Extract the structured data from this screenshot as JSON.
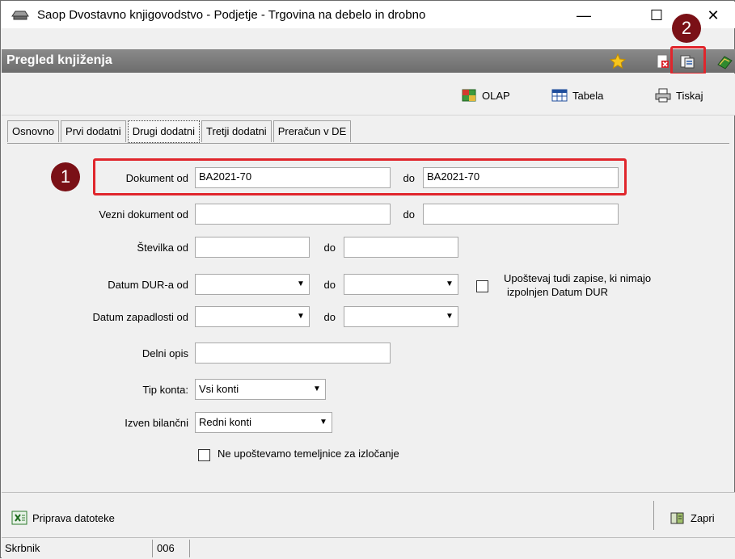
{
  "window": {
    "title": "Saop Dvostavno knjigovodstvo - Podjetje - Trgovina na debelo in drobno",
    "min": "—",
    "max": "☐",
    "close": "✕"
  },
  "header": {
    "title": "Pregled knjiženja"
  },
  "toolbar": {
    "olap": "OLAP",
    "tabela": "Tabela",
    "tiskaj": "Tiskaj"
  },
  "tabs": [
    "Osnovno",
    "Prvi dodatni",
    "Drugi dodatni",
    "Tretji dodatni",
    "Preračun v DE"
  ],
  "form": {
    "dokument_label": "Dokument od",
    "dokument_from": "BA2021-70",
    "dokument_to": "BA2021-70",
    "vezni_label": "Vezni dokument od",
    "vezni_from": "",
    "vezni_to": "",
    "stevilka_label": "Številka od",
    "stevilka_from": "",
    "stevilka_to": "",
    "datum_dur_label": "Datum DUR-a od",
    "datum_dur_from": "",
    "datum_dur_to": "",
    "zapadlost_label": "Datum zapadlosti od",
    "zapadlost_from": "",
    "zapadlost_to": "",
    "delni_label": "Delni opis",
    "delni_value": "",
    "tip_label": "Tip konta:",
    "tip_value": "Vsi konti",
    "izven_label": "Izven bilančni",
    "izven_value": "Redni konti",
    "do": "do",
    "upostevaj_line1": "Upoštevaj tudi zapise, ki nimajo",
    "upostevaj_line2": "izpolnjen Datum DUR",
    "temeljnice_label": "Ne upoštevamo temeljnice za izločanje"
  },
  "badges": {
    "one": "1",
    "two": "2"
  },
  "footer": {
    "priprava": "Priprava datoteke",
    "zapri": "Zapri"
  },
  "status": {
    "user": "Skrbnik",
    "code": "006"
  },
  "colors": {
    "annotation_red": "#e0262c",
    "badge": "#7a1016",
    "header_gray": "#7b7b7b"
  }
}
